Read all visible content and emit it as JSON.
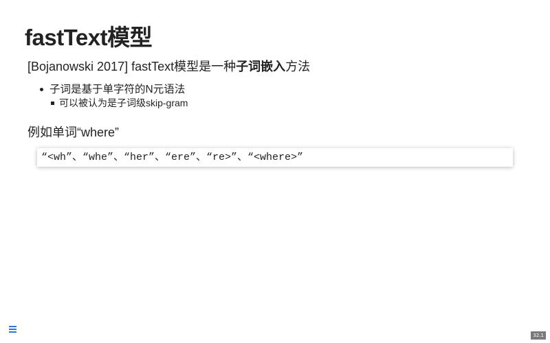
{
  "slide": {
    "title": "fastText模型",
    "subtitle": {
      "prefix": "[Bojanowski 2017] fastText模型是一种",
      "emphasis": "子词嵌入",
      "suffix": "方法"
    },
    "bullets": [
      {
        "text": "子词是基于单字符的N元语法",
        "sub_bullets": [
          "可以被认为是子词级skip-gram"
        ]
      }
    ],
    "example_heading": "例如单词“where”",
    "code": "“<wh”、“whe”、“her”、“ere”、“re>”、“<where>”"
  },
  "footer": {
    "menu_icon": "hamburger-menu-icon",
    "page_number": "32.1"
  },
  "colors": {
    "text": "#222222",
    "menu_accent": "#2a76dd",
    "page_badge": "#7a7a7a"
  }
}
